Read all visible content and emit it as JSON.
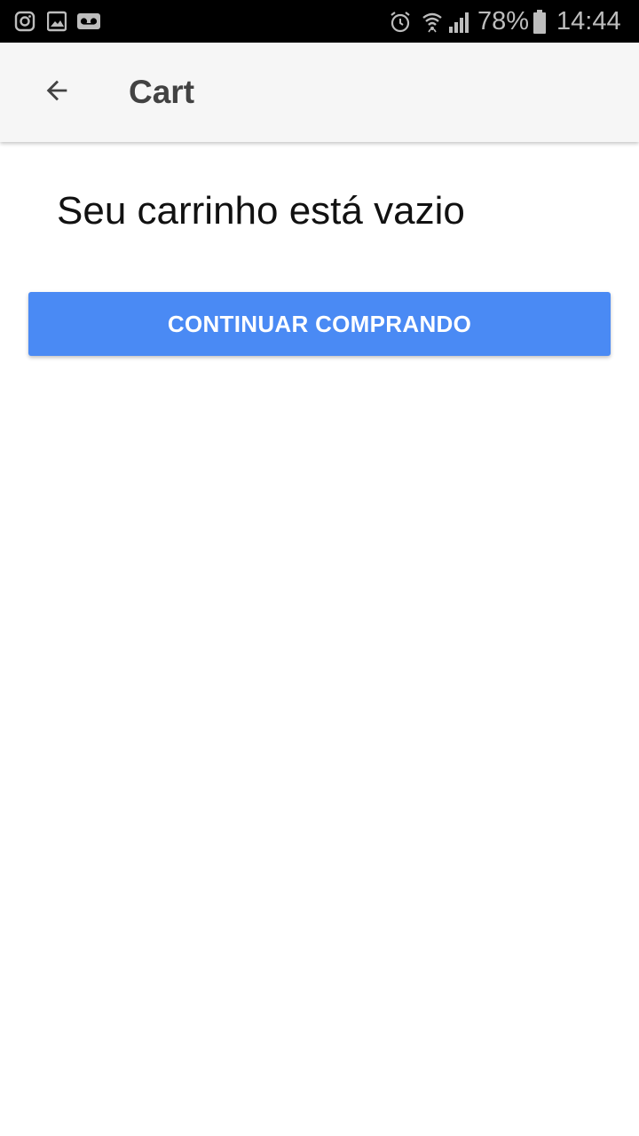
{
  "status_bar": {
    "battery": "78%",
    "time": "14:44",
    "left_icons": [
      "instagram-icon",
      "gallery-icon",
      "voicemail-icon"
    ],
    "right_icons": [
      "alarm-icon",
      "wifi-icon",
      "signal-icon",
      "battery-icon"
    ]
  },
  "app_bar": {
    "title": "Cart",
    "back_icon": "arrow-back-icon"
  },
  "cart": {
    "empty_message": "Seu carrinho está vazio",
    "continue_label": "CONTINUAR COMPRANDO"
  },
  "colors": {
    "status_bar_bg": "#000000",
    "app_bar_bg": "#f6f6f6",
    "accent_button": "#4a8af4",
    "title_text": "#424242"
  }
}
